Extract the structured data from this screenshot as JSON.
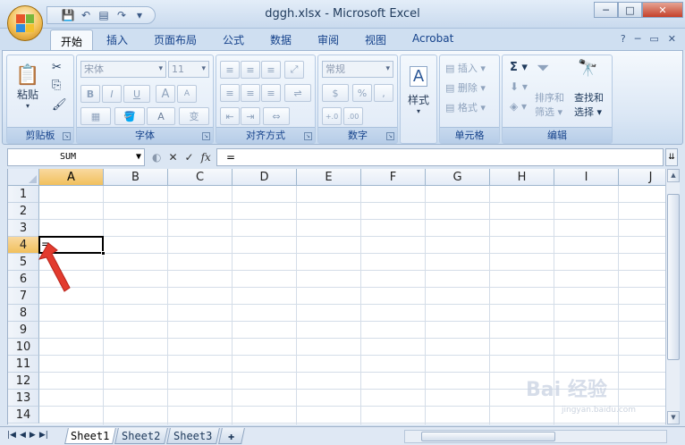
{
  "window": {
    "title": "dggh.xlsx - Microsoft Excel",
    "controls": [
      "─",
      "□",
      "✕"
    ]
  },
  "ribbon_tabs": [
    "开始",
    "插入",
    "页面布局",
    "公式",
    "数据",
    "审阅",
    "视图",
    "Acrobat"
  ],
  "ribbon_tab_right": [
    "?",
    "─",
    "▭",
    "✕"
  ],
  "groups": {
    "clipboard": {
      "label": "剪贴板",
      "paste": "粘贴"
    },
    "font": {
      "label": "字体",
      "font_name": "宋体",
      "font_size": "11",
      "bold": "B",
      "italic": "I",
      "underline": "U",
      "grow": "A",
      "shrink": "A",
      "font_color": "A",
      "phonetic": "变"
    },
    "alignment": {
      "label": "对齐方式"
    },
    "number": {
      "label": "数字",
      "format": "常规",
      "percent": "%",
      "comma": ","
    },
    "styles": {
      "label": "样式"
    },
    "cells": {
      "label": "单元格",
      "insert": "插入",
      "delete": "删除",
      "format": "格式"
    },
    "editing": {
      "label": "编辑",
      "sort": "排序和",
      "sort2": "筛选",
      "find": "查找和",
      "find2": "选择",
      "sigma": "Σ"
    }
  },
  "formula_bar": {
    "name_box": "SUM",
    "cancel": "✕",
    "enter": "✓",
    "fx": "fx",
    "content": "="
  },
  "columns": [
    "A",
    "B",
    "C",
    "D",
    "E",
    "F",
    "G",
    "H",
    "I",
    "J"
  ],
  "rows": [
    "1",
    "2",
    "3",
    "4",
    "5",
    "6",
    "7",
    "8",
    "9",
    "10",
    "11",
    "12",
    "13",
    "14"
  ],
  "active_cell": {
    "ref": "A4",
    "value": "="
  },
  "sheets": [
    "Sheet1",
    "Sheet2",
    "Sheet3"
  ],
  "sheet_nav": [
    "|◀",
    "◀",
    "▶",
    "▶|"
  ],
  "watermark": {
    "main": "Bai 经验",
    "sub": "jingyan.baidu.com"
  },
  "colors": {
    "accent": "#15428b",
    "selection": "#f1c05d",
    "arrow": "#e23b2e"
  }
}
